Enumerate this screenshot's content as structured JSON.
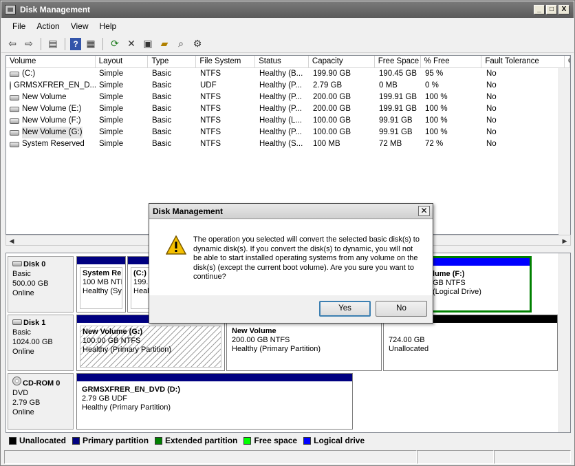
{
  "window": {
    "title": "Disk Management",
    "min": "_",
    "max": "□",
    "close": "X"
  },
  "menu": [
    "File",
    "Action",
    "View",
    "Help"
  ],
  "toolbar": [
    "back-icon",
    "forward-icon",
    "console-tree-icon",
    "help-icon",
    "list-view-icon",
    "refresh-icon",
    "delete-icon",
    "properties-icon",
    "open-icon",
    "search-icon",
    "settings-icon"
  ],
  "volume_list": {
    "headers": [
      "Volume",
      "Layout",
      "Type",
      "File System",
      "Status",
      "Capacity",
      "Free Space",
      "% Free",
      "Fault Tolerance",
      "O"
    ],
    "rows": [
      {
        "volume": "(C:)",
        "layout": "Simple",
        "type": "Basic",
        "fs": "NTFS",
        "status": "Healthy (B...",
        "capacity": "199.90 GB",
        "free": "190.45 GB",
        "pct": "95 %",
        "fault": "No",
        "icon": "disk"
      },
      {
        "volume": "GRMSXFRER_EN_D...",
        "layout": "Simple",
        "type": "Basic",
        "fs": "UDF",
        "status": "Healthy (P...",
        "capacity": "2.79 GB",
        "free": "0 MB",
        "pct": "0 %",
        "fault": "No",
        "icon": "cd"
      },
      {
        "volume": "New Volume",
        "layout": "Simple",
        "type": "Basic",
        "fs": "NTFS",
        "status": "Healthy (P...",
        "capacity": "200.00 GB",
        "free": "199.91 GB",
        "pct": "100 %",
        "fault": "No",
        "icon": "disk"
      },
      {
        "volume": "New Volume (E:)",
        "layout": "Simple",
        "type": "Basic",
        "fs": "NTFS",
        "status": "Healthy (P...",
        "capacity": "200.00 GB",
        "free": "199.91 GB",
        "pct": "100 %",
        "fault": "No",
        "icon": "disk"
      },
      {
        "volume": "New Volume (F:)",
        "layout": "Simple",
        "type": "Basic",
        "fs": "NTFS",
        "status": "Healthy (L...",
        "capacity": "100.00 GB",
        "free": "99.91 GB",
        "pct": "100 %",
        "fault": "No",
        "icon": "disk"
      },
      {
        "volume": "New Volume (G:)",
        "layout": "Simple",
        "type": "Basic",
        "fs": "NTFS",
        "status": "Healthy (P...",
        "capacity": "100.00 GB",
        "free": "99.91 GB",
        "pct": "100 %",
        "fault": "No",
        "icon": "disk",
        "selected": true
      },
      {
        "volume": "System Reserved",
        "layout": "Simple",
        "type": "Basic",
        "fs": "NTFS",
        "status": "Healthy (S...",
        "capacity": "100 MB",
        "free": "72 MB",
        "pct": "72 %",
        "fault": "No",
        "icon": "disk"
      }
    ]
  },
  "disks": {
    "disk0": {
      "name": "Disk 0",
      "type": "Basic",
      "size": "500.00 GB",
      "state": "Online",
      "p1": {
        "title": "System Re",
        "line1": "100 MB NTFS",
        "line2": "Healthy (Sys"
      },
      "p2": {
        "title": "(C:)",
        "line1": "199.9",
        "line2": "Healt"
      },
      "p3": {
        "title": "lume  (F:)",
        "line1": "GB NTFS",
        "line2": "(Logical Drive)"
      }
    },
    "disk1": {
      "name": "Disk 1",
      "type": "Basic",
      "size": "1024.00 GB",
      "state": "Online",
      "p1": {
        "title": "New Volume  (G:)",
        "line1": "100.00 GB NTFS",
        "line2": "Healthy (Primary Partition)"
      },
      "p2": {
        "title": "New Volume",
        "line1": "200.00 GB NTFS",
        "line2": "Healthy (Primary Partition)"
      },
      "p3": {
        "line1": "724.00 GB",
        "line2": "Unallocated"
      }
    },
    "cdrom0": {
      "name": "CD-ROM 0",
      "type": "DVD",
      "size": "2.79 GB",
      "state": "Online",
      "p1": {
        "title": "GRMSXFRER_EN_DVD  (D:)",
        "line1": "2.79 GB UDF",
        "line2": "Healthy (Primary Partition)"
      }
    }
  },
  "legend": [
    {
      "label": "Unallocated",
      "color": "#000000"
    },
    {
      "label": "Primary partition",
      "color": "#000080"
    },
    {
      "label": "Extended partition",
      "color": "#008000"
    },
    {
      "label": "Free space",
      "color": "#00ff00"
    },
    {
      "label": "Logical drive",
      "color": "#0000ff"
    }
  ],
  "dialog": {
    "title": "Disk Management",
    "message": "The operation you selected will convert the selected basic disk(s) to dynamic disk(s). If you convert the disk(s) to dynamic, you will not be able to start installed operating systems from any volume on the disk(s) (except the current boot volume). Are you sure you want to continue?",
    "yes": "Yes",
    "no": "No"
  }
}
